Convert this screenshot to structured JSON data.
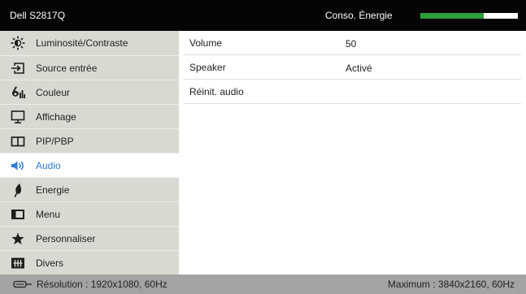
{
  "header": {
    "model": "Dell S2817Q",
    "energy_label": "Conso. Énergie",
    "energy_level": 0.65
  },
  "sidebar": {
    "items": [
      {
        "label": "Luminosité/Contraste",
        "icon": "brightness-contrast-icon",
        "selected": false
      },
      {
        "label": "Source entrée",
        "icon": "input-source-icon",
        "selected": false
      },
      {
        "label": "Couleur",
        "icon": "color-icon",
        "selected": false
      },
      {
        "label": "Affichage",
        "icon": "display-icon",
        "selected": false
      },
      {
        "label": "PIP/PBP",
        "icon": "pip-pbp-icon",
        "selected": false
      },
      {
        "label": "Audio",
        "icon": "speaker-icon",
        "selected": true
      },
      {
        "label": "Energie",
        "icon": "energy-icon",
        "selected": false
      },
      {
        "label": "Menu",
        "icon": "menu-icon",
        "selected": false
      },
      {
        "label": "Personnaliser",
        "icon": "star-icon",
        "selected": false
      },
      {
        "label": "Divers",
        "icon": "misc-icon",
        "selected": false
      }
    ]
  },
  "audio": {
    "rows": [
      {
        "label": "Volume",
        "value": "50"
      },
      {
        "label": "Speaker",
        "value": "Activé"
      },
      {
        "label": "Réinit. audio"
      }
    ]
  },
  "footer": {
    "connector_icon": "cable-connector-icon",
    "resolution": "Résolution : 1920x1080, 60Hz",
    "maximum": "Maximum : 3840x2160, 60Hz"
  },
  "colors": {
    "header_bg": "#050505",
    "sidebar_bg": "#d9d9d4",
    "selected_text": "#2f7bd6",
    "energy_fill": "#2e9f3c",
    "footer_bg": "#a3a3a3"
  }
}
